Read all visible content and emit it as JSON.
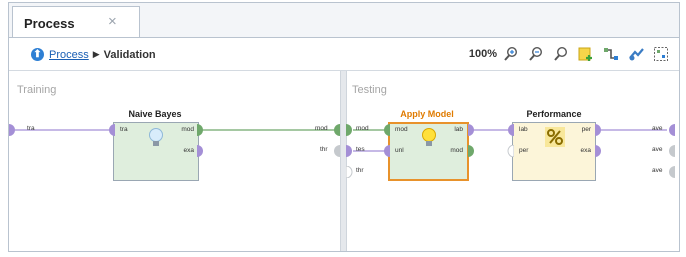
{
  "tab": {
    "title": "Process",
    "close_symbol": "×"
  },
  "breadcrumb": {
    "root": "Process",
    "separator": "▶",
    "current": "Validation"
  },
  "toolbar": {
    "zoom_level": "100%",
    "tools": [
      "zoom-in-icon",
      "zoom-out-icon",
      "zoom-fit-icon",
      "add-note-icon",
      "auto-wire-icon",
      "show-order-icon",
      "arrange-icon"
    ]
  },
  "training": {
    "title": "Training",
    "source_port": "tra",
    "operator": {
      "name": "Naive Bayes",
      "in_ports": [
        "tra"
      ],
      "out_ports": [
        "mod",
        "exa"
      ],
      "icon": "lightbulb-icon"
    },
    "sink_port": "mod"
  },
  "testing": {
    "title": "Testing",
    "source_ports": [
      "mod",
      "tes",
      "thr"
    ],
    "apply_model": {
      "name": "Apply Model",
      "in_ports": [
        "mod",
        "unl"
      ],
      "out_ports": [
        "lab",
        "mod"
      ],
      "icon": "lightbulb-icon",
      "title_color": "#e07b00"
    },
    "performance": {
      "name": "Performance",
      "in_ports": [
        "lab",
        "per"
      ],
      "out_ports": [
        "per",
        "exa"
      ],
      "icon": "percent-icon"
    },
    "sink_ports": [
      "ave",
      "ave",
      "ave"
    ]
  },
  "colors": {
    "operator_fill": "#dfeedd",
    "apply_model_border": "#e8922b",
    "performance_fill": "#fcf5d9",
    "port_purple": "#a48fd6",
    "port_green": "#6fa86b",
    "port_grey": "#c5c9cd"
  },
  "thr_left_label": "thr"
}
